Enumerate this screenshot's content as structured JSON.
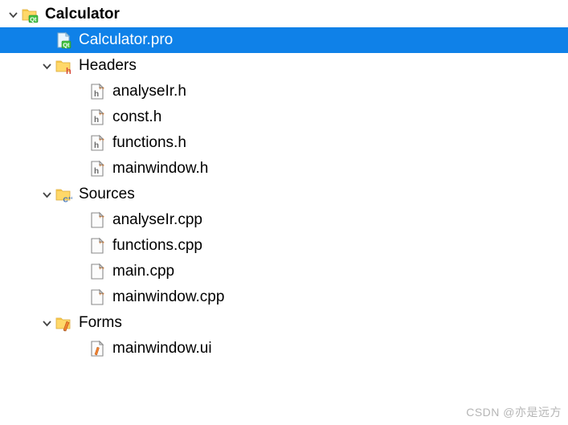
{
  "tree": {
    "root": {
      "label": "Calculator",
      "icon": "qt-project-folder",
      "expanded": true,
      "bold": true
    },
    "pro_file": {
      "label": "Calculator.pro",
      "icon": "qt-pro-file",
      "selected": true
    },
    "headers": {
      "label": "Headers",
      "icon": "header-folder",
      "expanded": true,
      "items": [
        {
          "label": "analyseIr.h",
          "icon": "h-file"
        },
        {
          "label": "const.h",
          "icon": "h-file"
        },
        {
          "label": "functions.h",
          "icon": "h-file"
        },
        {
          "label": "mainwindow.h",
          "icon": "h-file"
        }
      ]
    },
    "sources": {
      "label": "Sources",
      "icon": "cpp-folder",
      "expanded": true,
      "items": [
        {
          "label": "analyseIr.cpp",
          "icon": "cpp-file"
        },
        {
          "label": "functions.cpp",
          "icon": "cpp-file"
        },
        {
          "label": "main.cpp",
          "icon": "cpp-file"
        },
        {
          "label": "mainwindow.cpp",
          "icon": "cpp-file"
        }
      ]
    },
    "forms": {
      "label": "Forms",
      "icon": "form-folder",
      "expanded": true,
      "items": [
        {
          "label": "mainwindow.ui",
          "icon": "ui-file"
        }
      ]
    }
  },
  "watermark": "CSDN @亦是远方"
}
